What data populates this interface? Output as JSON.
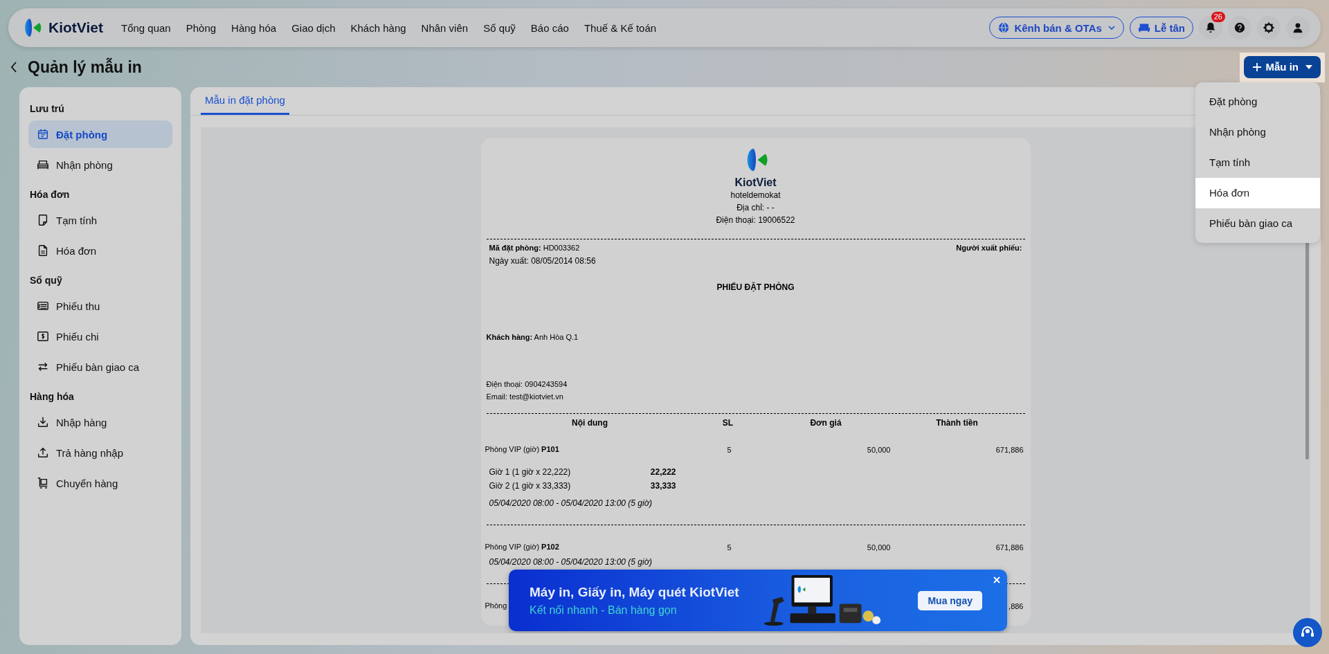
{
  "nav": {
    "brand": "KiotViet",
    "items": [
      "Tổng quan",
      "Phòng",
      "Hàng hóa",
      "Giao dịch",
      "Khách hàng",
      "Nhân viên",
      "Sổ quỹ",
      "Báo cáo",
      "Thuế & Kế toán"
    ],
    "channel_button": "Kênh bán & OTAs",
    "reception_button": "Lễ tân",
    "notification_count": "26"
  },
  "page": {
    "title": "Quản lý mẫu in",
    "add_button": "Mẫu in"
  },
  "menu": [
    {
      "label": "Đặt phòng",
      "selected": false
    },
    {
      "label": "Nhận phòng",
      "selected": false
    },
    {
      "label": "Tạm tính",
      "selected": false
    },
    {
      "label": "Hóa đơn",
      "selected": true
    },
    {
      "label": "Phiếu bàn giao ca",
      "selected": false
    }
  ],
  "sidebar": [
    {
      "heading": "Lưu trú",
      "items": [
        {
          "label": "Đặt phòng",
          "kind": "calendar",
          "selected": true
        },
        {
          "label": "Nhận phòng",
          "kind": "bed",
          "selected": false
        }
      ]
    },
    {
      "heading": "Hóa đơn",
      "items": [
        {
          "label": "Tạm tính",
          "kind": "note",
          "selected": false
        },
        {
          "label": "Hóa đơn",
          "kind": "document",
          "selected": false
        }
      ]
    },
    {
      "heading": "Sổ quỹ",
      "items": [
        {
          "label": "Phiếu thu",
          "kind": "receipt",
          "selected": false
        },
        {
          "label": "Phiếu chi",
          "kind": "money",
          "selected": false
        },
        {
          "label": "Phiếu bàn giao ca",
          "kind": "swap",
          "selected": false
        }
      ]
    },
    {
      "heading": "Hàng hóa",
      "items": [
        {
          "label": "Nhập hàng",
          "kind": "import",
          "selected": false
        },
        {
          "label": "Trả hàng nhập",
          "kind": "export",
          "selected": false
        },
        {
          "label": "Chuyển hàng",
          "kind": "cart",
          "selected": false
        }
      ]
    }
  ],
  "tabs": [
    {
      "label": "Mẫu in đặt phòng",
      "selected": true
    }
  ],
  "receipt": {
    "brand": "KiotViet",
    "store": "hoteldemokat",
    "address": "Địa chỉ: - -",
    "phone": "Điện thoại: 19006522",
    "code": "**Mã đặt phòng:** HD003362",
    "issuer": "Người xuất phiếu:",
    "date": "Ngày xuất: 08/05/2014 08:56",
    "title": "PHIẾU ĐẶT PHÒNG",
    "customer": "**Khách hàng:** Anh Hòa Q.1",
    "customer_phone": "Điện thoại: 0904243594",
    "email": "Email: test@kiotviet.vn",
    "columns": [
      "Nội dung",
      "SL",
      "Đơn giá",
      "Thành tiền"
    ],
    "rows": [
      {
        "name": "Phòng VIP (giờ) **P101**",
        "qty": "5",
        "price": "50,000",
        "total": "671,886",
        "hours": [
          {
            "label": "Giờ 1 (1 giờ x 22,222)",
            "amount": "22,222"
          },
          {
            "label": "Giờ 2 (1 giờ x 33,333)",
            "amount": "33,333"
          }
        ],
        "period": "05/04/2020 08:00 - 05/04/2020 13:00 (5 giờ)"
      },
      {
        "name": "Phòng VIP (giờ) **P102**",
        "qty": "5",
        "price": "50,000",
        "total": "671,886",
        "period": "05/04/2020 08:00 - 05/04/2020 13:00 (5 giờ)"
      },
      {
        "name": "Phòng",
        "total": ",886"
      }
    ]
  },
  "banner": {
    "title": "Máy in, Giấy in, Máy quét KiotViet",
    "subtitle": "Kết nối nhanh - Bán hàng gọn",
    "button": "Mua ngay"
  }
}
